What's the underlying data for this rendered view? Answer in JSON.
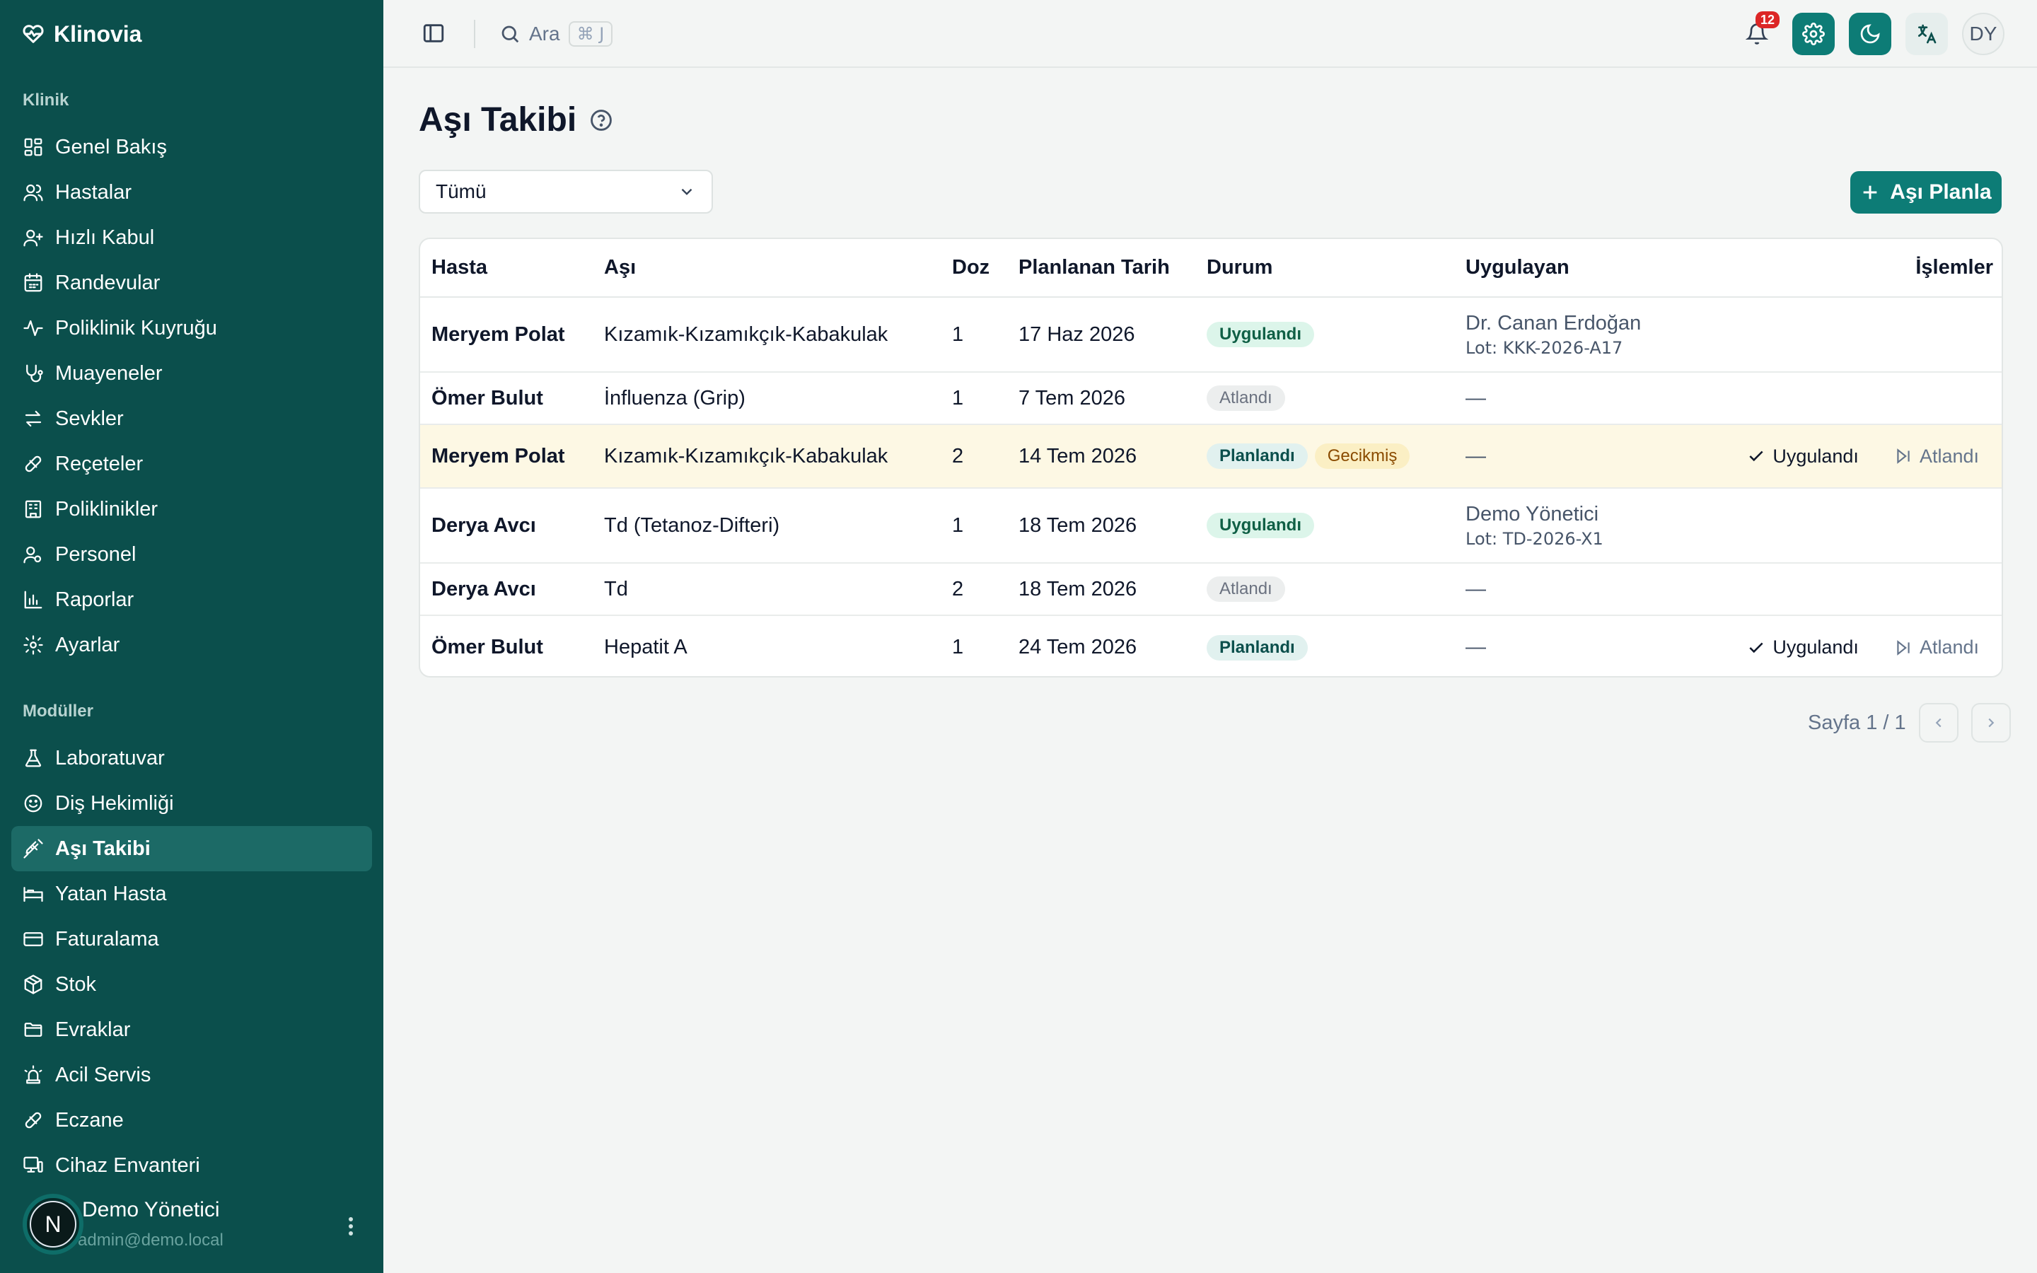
{
  "app": {
    "name": "Klinovia"
  },
  "sidebar": {
    "section_clinic": "Klinik",
    "clinic_items": [
      {
        "label": "Genel Bakış",
        "icon": "dashboard-icon"
      },
      {
        "label": "Hastalar",
        "icon": "users-icon"
      },
      {
        "label": "Hızlı Kabul",
        "icon": "user-plus-icon"
      },
      {
        "label": "Randevular",
        "icon": "calendar-icon"
      },
      {
        "label": "Poliklinik Kuyruğu",
        "icon": "activity-icon"
      },
      {
        "label": "Muayeneler",
        "icon": "stethoscope-icon"
      },
      {
        "label": "Sevkler",
        "icon": "transfer-icon"
      },
      {
        "label": "Reçeteler",
        "icon": "pill-icon"
      },
      {
        "label": "Poliklinikler",
        "icon": "building-icon"
      },
      {
        "label": "Personel",
        "icon": "staff-icon"
      },
      {
        "label": "Raporlar",
        "icon": "chart-icon"
      },
      {
        "label": "Ayarlar",
        "icon": "gear-icon"
      }
    ],
    "section_modules": "Modüller",
    "module_items": [
      {
        "label": "Laboratuvar",
        "icon": "flask-icon"
      },
      {
        "label": "Diş Hekimliği",
        "icon": "smile-icon"
      },
      {
        "label": "Aşı Takibi",
        "icon": "syringe-icon",
        "active": true
      },
      {
        "label": "Yatan Hasta",
        "icon": "bed-icon"
      },
      {
        "label": "Faturalama",
        "icon": "credit-card-icon"
      },
      {
        "label": "Stok",
        "icon": "package-icon"
      },
      {
        "label": "Evraklar",
        "icon": "folder-icon"
      },
      {
        "label": "Acil Servis",
        "icon": "siren-icon"
      },
      {
        "label": "Eczane",
        "icon": "pill-icon"
      },
      {
        "label": "Cihaz Envanteri",
        "icon": "monitor-icon"
      }
    ],
    "user": {
      "initial": "N",
      "name": "Demo Yönetici",
      "email": "admin@demo.local"
    }
  },
  "header": {
    "search_label": "Ara",
    "search_shortcut": "⌘ J",
    "notification_count": "12",
    "avatar_initials": "DY"
  },
  "main": {
    "title": "Aşı Takibi",
    "filter_value": "Tümü",
    "primary_button": "Aşı Planla",
    "columns": [
      "Hasta",
      "Aşı",
      "Doz",
      "Planlanan Tarih",
      "Durum",
      "Uygulayan",
      "İşlemler"
    ],
    "rows": [
      {
        "patient": "Meryem Polat",
        "vaccine": "Kızamık-Kızamıkçık-Kabakulak",
        "dose": "1",
        "date": "17 Haz 2026",
        "statuses": [
          {
            "label": "Uygulandı",
            "kind": "green"
          }
        ],
        "by": "Dr. Canan Erdoğan",
        "lot": "Lot: KKK-2026-A17",
        "actions": false,
        "highlight": false
      },
      {
        "patient": "Ömer Bulut",
        "vaccine": "İnfluenza (Grip)",
        "dose": "1",
        "date": "7 Tem 2026",
        "statuses": [
          {
            "label": "Atlandı",
            "kind": "gray"
          }
        ],
        "by": "—",
        "lot": "",
        "actions": false,
        "highlight": false
      },
      {
        "patient": "Meryem Polat",
        "vaccine": "Kızamık-Kızamıkçık-Kabakulak",
        "dose": "2",
        "date": "14 Tem 2026",
        "statuses": [
          {
            "label": "Planlandı",
            "kind": "teal"
          },
          {
            "label": "Gecikmiş",
            "kind": "amber"
          }
        ],
        "by": "—",
        "lot": "",
        "actions": true,
        "highlight": true
      },
      {
        "patient": "Derya Avcı",
        "vaccine": "Td (Tetanoz-Difteri)",
        "dose": "1",
        "date": "18 Tem 2026",
        "statuses": [
          {
            "label": "Uygulandı",
            "kind": "green"
          }
        ],
        "by": "Demo Yönetici",
        "lot": "Lot: TD-2026-X1",
        "actions": false,
        "highlight": false
      },
      {
        "patient": "Derya Avcı",
        "vaccine": "Td",
        "dose": "2",
        "date": "18 Tem 2026",
        "statuses": [
          {
            "label": "Atlandı",
            "kind": "gray"
          }
        ],
        "by": "—",
        "lot": "",
        "actions": false,
        "highlight": false
      },
      {
        "patient": "Ömer Bulut",
        "vaccine": "Hepatit A",
        "dose": "1",
        "date": "24 Tem 2026",
        "statuses": [
          {
            "label": "Planlandı",
            "kind": "teal"
          }
        ],
        "by": "—",
        "lot": "",
        "actions": true,
        "highlight": false
      }
    ],
    "action_apply": "Uygulandı",
    "action_skip": "Atlandı",
    "pagination": "Sayfa 1 / 1"
  },
  "colors": {
    "sidebar_bg": "#0b4f4c",
    "accent": "#0d7c76",
    "highlight_row": "#fdf8e4"
  }
}
